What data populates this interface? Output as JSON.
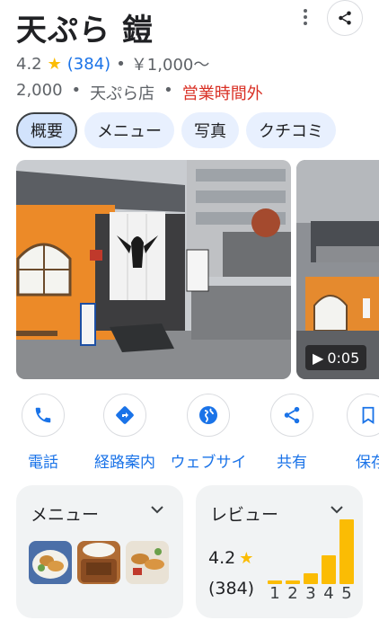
{
  "place": {
    "name": "天ぷら 鎧",
    "rating": "4.2",
    "review_count": "(384)",
    "price": "￥1,000～",
    "price_range": "2,000",
    "category": "天ぷら店",
    "status": "営業時間外",
    "separator": "•"
  },
  "tabs": [
    {
      "label": "概要",
      "active": true
    },
    {
      "label": "メニュー",
      "active": false
    },
    {
      "label": "写真",
      "active": false
    },
    {
      "label": "クチコミ",
      "active": false
    }
  ],
  "photos": {
    "video_duration": "0:05"
  },
  "actions": [
    {
      "label": "電話",
      "icon": "phone-icon"
    },
    {
      "label": "経路案内",
      "icon": "directions-icon"
    },
    {
      "label": "ウェブサイ",
      "icon": "globe-icon"
    },
    {
      "label": "共有",
      "icon": "share-icon"
    },
    {
      "label": "保存",
      "icon": "bookmark-icon"
    }
  ],
  "menu_card": {
    "title": "メニュー"
  },
  "review_card": {
    "title": "レビュー",
    "rating": "4.2",
    "count": "(384)",
    "histogram": [
      {
        "star": "1",
        "fraction": 0.06
      },
      {
        "star": "2",
        "fraction": 0.06
      },
      {
        "star": "3",
        "fraction": 0.17
      },
      {
        "star": "4",
        "fraction": 0.45
      },
      {
        "star": "5",
        "fraction": 1.0
      }
    ]
  },
  "colors": {
    "accent": "#1a73e8",
    "star": "#fbbc04",
    "closed": "#d93025",
    "chip_bg": "#e8f0fe"
  }
}
